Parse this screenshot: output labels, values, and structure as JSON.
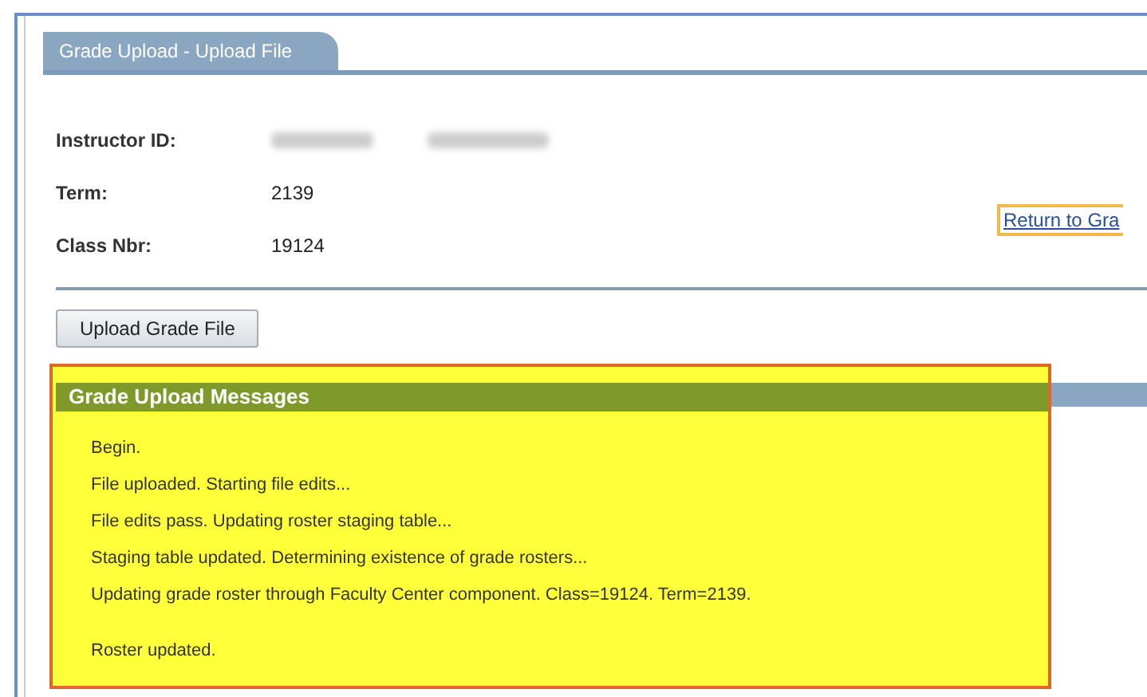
{
  "tab": {
    "label": "Grade Upload - Upload File",
    "selected": true
  },
  "fields": [
    {
      "label": "Instructor ID:",
      "kind": "redacted"
    },
    {
      "label": "Term:",
      "kind": "text",
      "value": "2139"
    },
    {
      "label": "Class Nbr:",
      "kind": "text",
      "value": "19124"
    }
  ],
  "return_link": "Return to Gra",
  "upload_button": "Upload Grade File",
  "messages": {
    "title": "Grade Upload Messages",
    "lines": [
      "Begin.",
      "File uploaded. Starting file edits...",
      "File edits pass. Updating roster staging table...",
      "Staging table updated. Determining existence of grade rosters...",
      "Updating grade roster through Faculty Center component. Class=19124. Term=2139.",
      "Roster updated."
    ]
  }
}
